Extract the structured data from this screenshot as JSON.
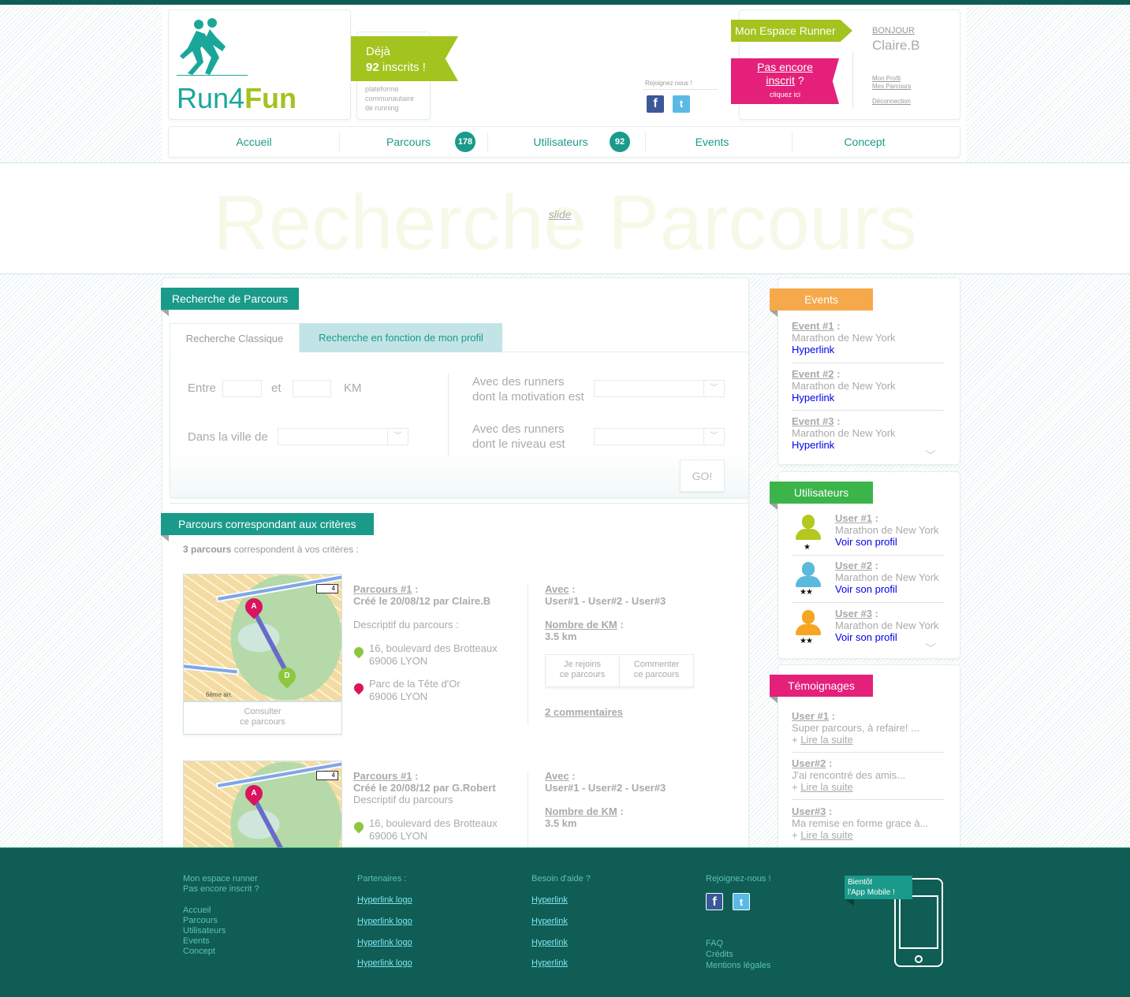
{
  "brand": {
    "name_part1": "Run4",
    "name_part2": "Fun"
  },
  "signup_banner": {
    "line1": "Déjà",
    "count": "92",
    "line2": "inscrits !",
    "tagline_1": "plateforme",
    "tagline_2": "communautaire",
    "tagline_3": "de running"
  },
  "social_header": {
    "label": "Rejoignez nous !"
  },
  "account": {
    "espace_runner": "Mon Espace Runner",
    "pas_encore_line1": "Pas encore",
    "pas_encore_line2": "inscrit",
    "pas_encore_q": " ?",
    "cliquez": "cliquez ici",
    "bonjour": "BONJOUR",
    "username": "Claire.B",
    "mon_profil": "Mon Profil",
    "mes_parcours": "Mes Parcours",
    "deconnexion": "Déconnection"
  },
  "nav": {
    "accueil": "Accueil",
    "parcours": "Parcours",
    "parcours_count": "178",
    "utilisateurs": "Utilisateurs",
    "utilisateurs_count": "92",
    "events": "Events",
    "concept": "Concept"
  },
  "hero": {
    "title": "Recherche Parcours",
    "slide_link": "slide"
  },
  "search": {
    "section_title": "Recherche de Parcours",
    "tab_classic": "Recherche Classique",
    "tab_profile": "Recherche en fonction de mon profil",
    "entre": "Entre",
    "et": "et",
    "km": "KM",
    "ville": "Dans la ville de",
    "motivation_1": "Avec des runners",
    "motivation_2": "dont la motivation est",
    "niveau_1": "Avec des runners",
    "niveau_2": "dont le niveau est",
    "go": "GO!"
  },
  "results": {
    "section_title": "Parcours correspondant aux critères",
    "summary_bold": "3 parcours",
    "summary_rest": " correspondent à vos critères :",
    "items": [
      {
        "title": "Parcours #1",
        "created": "Créé le 20/08/12 par Claire.B",
        "descriptif": "Descriptif du parcours :",
        "start_1": "16, boulevard des Brotteaux",
        "start_2": "69006 LYON",
        "end_1": "Parc de la Tête d'Or",
        "end_2": "69006 LYON",
        "avec_label": "Avec",
        "avec": "User#1 - User#2 - User#3",
        "km_label": "Nombre de KM",
        "km": "3.5 km",
        "join_1": "Je rejoins",
        "join_2": "ce parcours",
        "comment_1": "Commenter",
        "comment_2": "ce parcours",
        "comments_link": "2 commentaires",
        "consult_1": "Consulter",
        "consult_2": "ce parcours"
      },
      {
        "title": "Parcours #1",
        "created": "Créé le 20/08/12 par G.Robert",
        "descriptif": "Descriptif du parcours",
        "start_1": "16, boulevard des Brotteaux",
        "start_2": "69006 LYON",
        "avec_label": "Avec",
        "avec": "User#1 - User#2 - User#3",
        "km_label": "Nombre de KM",
        "km": "3.5 km"
      }
    ],
    "map_labels": {
      "pin_a": "A",
      "pin_d": "D",
      "area_text": "6ème arr.",
      "sign": "4"
    }
  },
  "events": {
    "title": "Events",
    "items": [
      {
        "label": "Event #1",
        "desc": "Marathon de New York",
        "link": "Hyperlink"
      },
      {
        "label": "Event #2",
        "desc": "Marathon de New York",
        "link": "Hyperlink"
      },
      {
        "label": "Event #3",
        "desc": "Marathon de New York",
        "link": "Hyperlink"
      }
    ]
  },
  "users": {
    "title": "Utilisateurs",
    "items": [
      {
        "label": "User #1",
        "desc": "Marathon de New York",
        "link": "Voir son profil",
        "stars": "★",
        "color": "#b5c820"
      },
      {
        "label": "User #2",
        "desc": "Marathon de New York",
        "link": "Voir son profil",
        "stars": "★★",
        "color": "#5bb9dc"
      },
      {
        "label": "User #3",
        "desc": "Marathon de New York",
        "link": "Voir son profil",
        "stars": "★★",
        "color": "#f6a623"
      }
    ]
  },
  "temoignages": {
    "title": "Témoignages",
    "items": [
      {
        "label": "User #1",
        "text": "Super parcours, à refaire! ...",
        "more": "Lire la suite"
      },
      {
        "label": "User#2",
        "text": "J'ai rencontré des amis...",
        "more": "Lire la suite"
      },
      {
        "label": "User#3",
        "text": "Ma remise en forme grace à...",
        "more": "Lire la suite"
      }
    ],
    "plus": "+ "
  },
  "footer": {
    "col1": [
      "Mon espace runner",
      "Pas encore inscrit ?"
    ],
    "col1b": [
      "Accueil",
      "Parcours",
      "Utilisateurs",
      "Events",
      "Concept"
    ],
    "partners_title": "Partenaires :",
    "partners": [
      "Hyperlink logo",
      "Hyperlink logo",
      "Hyperlink logo",
      "Hyperlink logo"
    ],
    "help_title": "Besoin d'aide ?",
    "help": [
      "Hyperlink",
      "Hyperlink",
      "Hyperlink",
      "Hyperlink"
    ],
    "join_title": "Rejoignez-nous !",
    "legal": [
      "FAQ",
      "Crédits",
      "Mentions légales"
    ],
    "app_1": "Bientôt",
    "app_2": "l'App Mobile !"
  },
  "colors": {
    "teal": "#1a9a8a",
    "dark_green": "#0f5d55",
    "lime": "#a3c31e",
    "pink": "#e4207a",
    "orange": "#f6a94a",
    "green": "#3bb54a"
  },
  "icons": {
    "facebook": "facebook-icon",
    "twitter": "twitter-icon",
    "dropdown": "chevron-down-icon",
    "star": "star-icon",
    "phone": "phone-icon"
  }
}
